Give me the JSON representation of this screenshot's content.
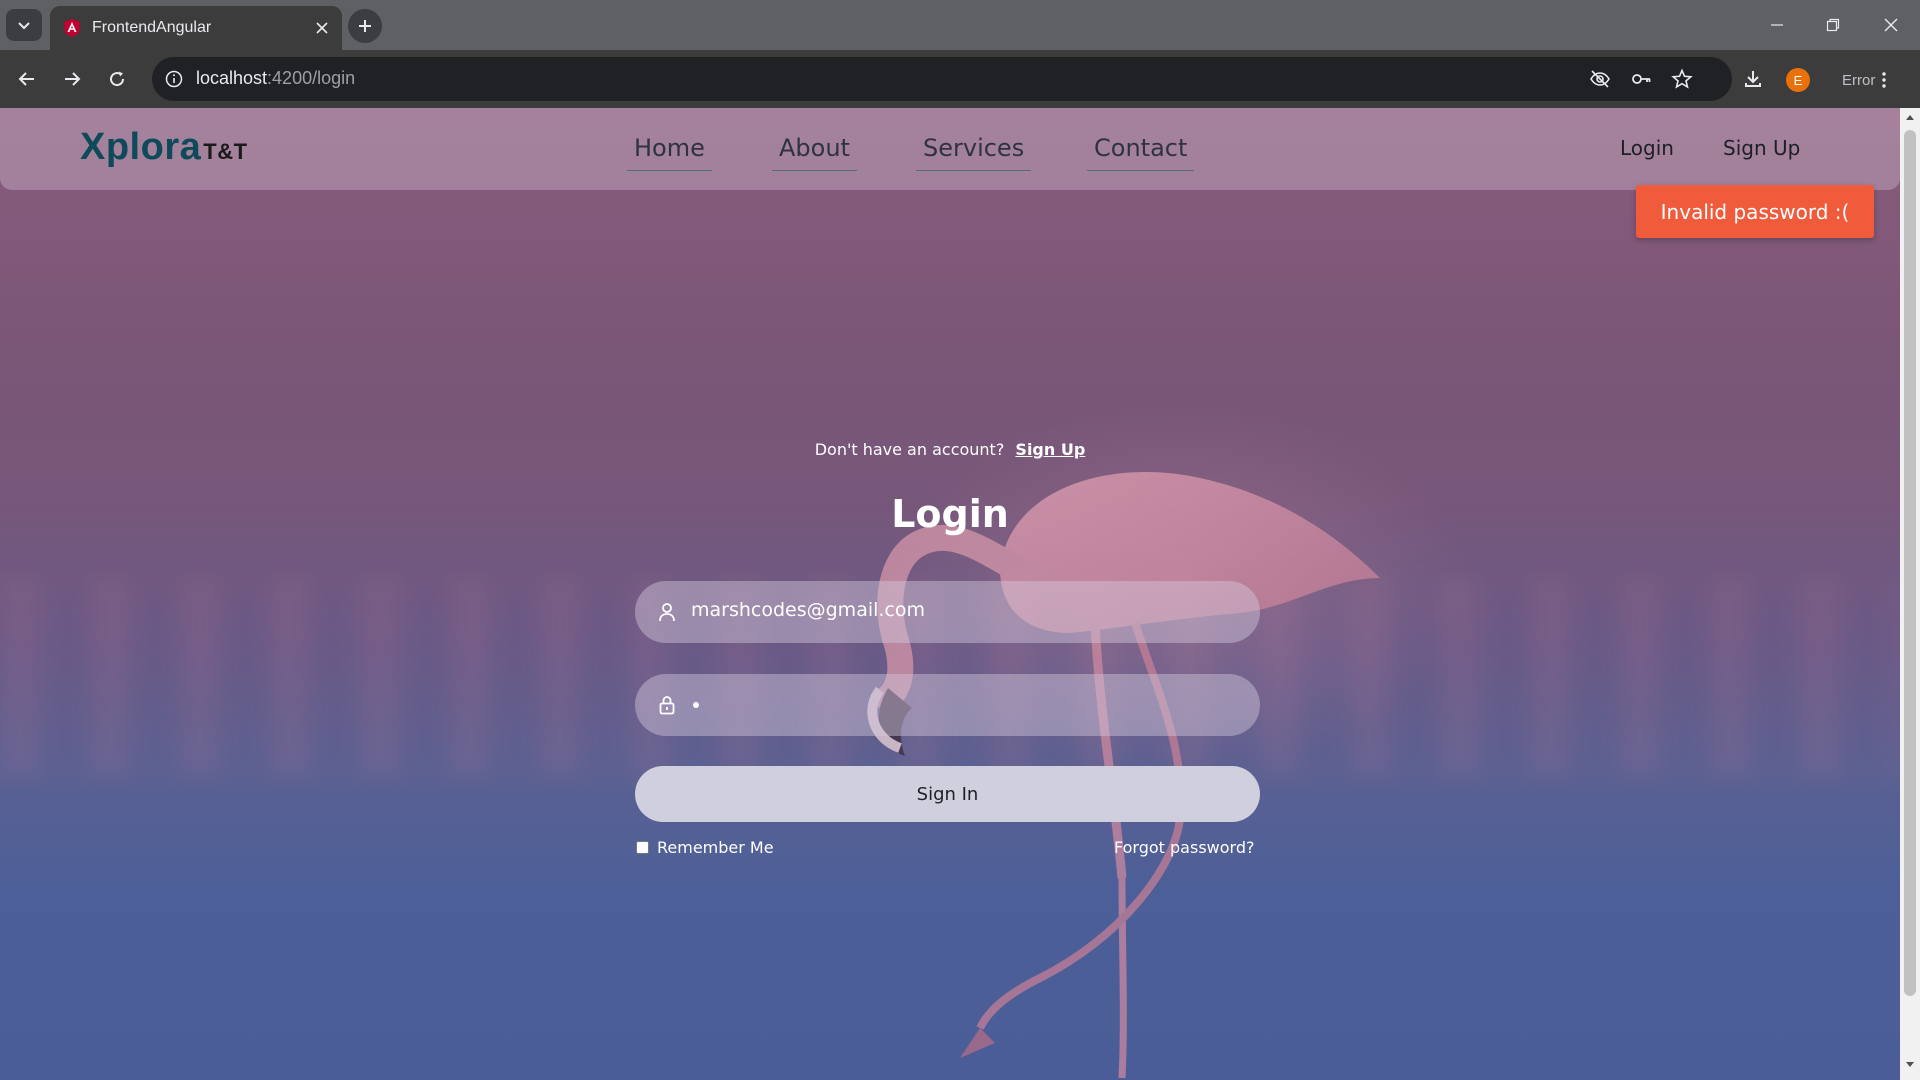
{
  "browser": {
    "tab_title": "FrontendAngular",
    "url_host": "localhost",
    "url_path": ":4200/login",
    "profile_initial": "E",
    "status_label": "Error"
  },
  "navbar": {
    "brand": "Xplora",
    "brand_suffix": "T&T",
    "links": [
      "Home",
      "About",
      "Services",
      "Contact"
    ],
    "login_label": "Login",
    "signup_label": "Sign Up"
  },
  "toast": {
    "message": "Invalid password :(",
    "color": "#ef5b3b"
  },
  "login_form": {
    "no_account_text": "Don't have an account?",
    "signup_link": "Sign Up",
    "title": "Login",
    "email_value": "marshcodes@gmail.com",
    "password_mask": "•",
    "submit_label": "Sign In",
    "remember_label": "Remember Me",
    "remember_checked": false,
    "forgot_label": "Forgot password?"
  }
}
